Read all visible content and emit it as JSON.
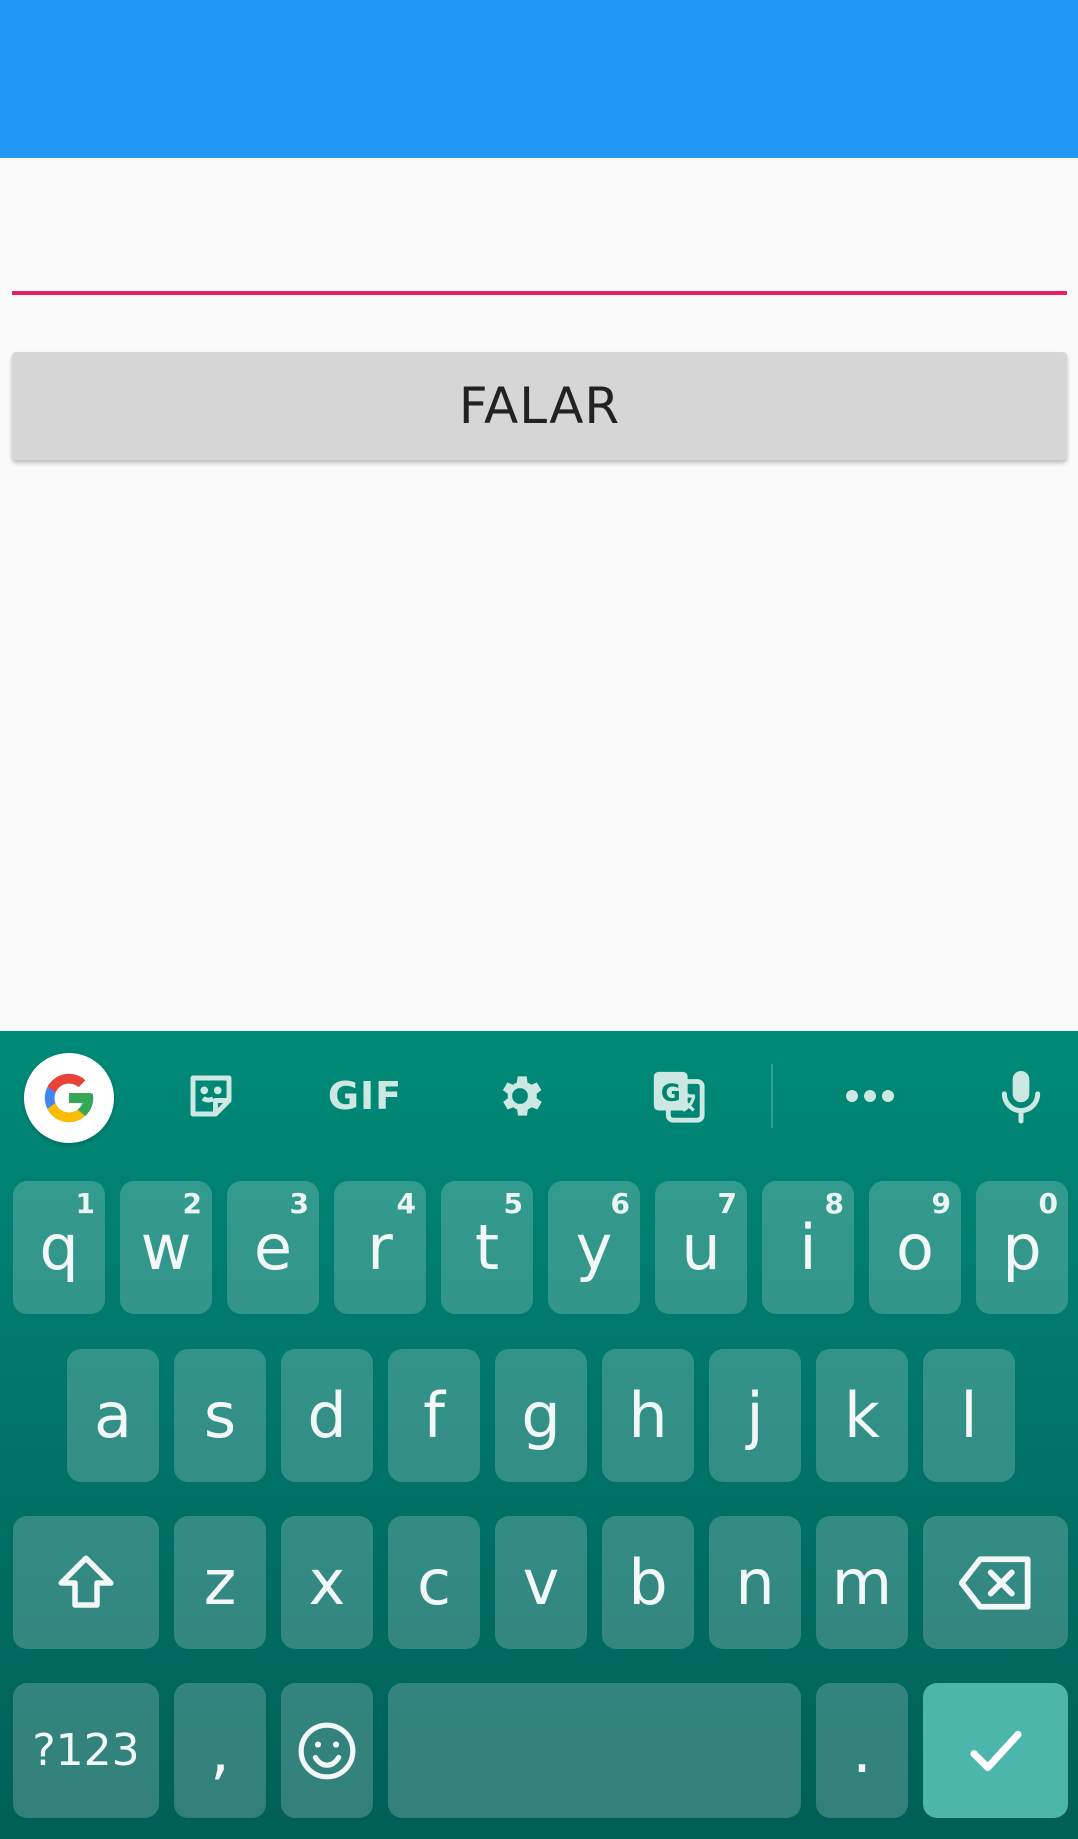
{
  "main": {
    "input_value": "",
    "button_label": "FALAR"
  },
  "colors": {
    "app_bar": "#2196F3",
    "input_underline": "#E91E63",
    "keyboard": "#00796B",
    "enter_key": "#4DB6AC"
  },
  "keyboard": {
    "toolbar": {
      "gif_label": "GIF",
      "icons": [
        "google-g-icon",
        "sticker-icon",
        "gif-icon",
        "gear-icon",
        "translate-icon",
        "more-icon",
        "microphone-icon"
      ]
    },
    "row1": [
      {
        "label": "q",
        "hint": "1"
      },
      {
        "label": "w",
        "hint": "2"
      },
      {
        "label": "e",
        "hint": "3"
      },
      {
        "label": "r",
        "hint": "4"
      },
      {
        "label": "t",
        "hint": "5"
      },
      {
        "label": "y",
        "hint": "6"
      },
      {
        "label": "u",
        "hint": "7"
      },
      {
        "label": "i",
        "hint": "8"
      },
      {
        "label": "o",
        "hint": "9"
      },
      {
        "label": "p",
        "hint": "0"
      }
    ],
    "row2": [
      "a",
      "s",
      "d",
      "f",
      "g",
      "h",
      "j",
      "k",
      "l"
    ],
    "row3": [
      "z",
      "x",
      "c",
      "v",
      "b",
      "n",
      "m"
    ],
    "bottom": {
      "symbols_label": "?123",
      "comma_label": ",",
      "period_label": "."
    }
  }
}
